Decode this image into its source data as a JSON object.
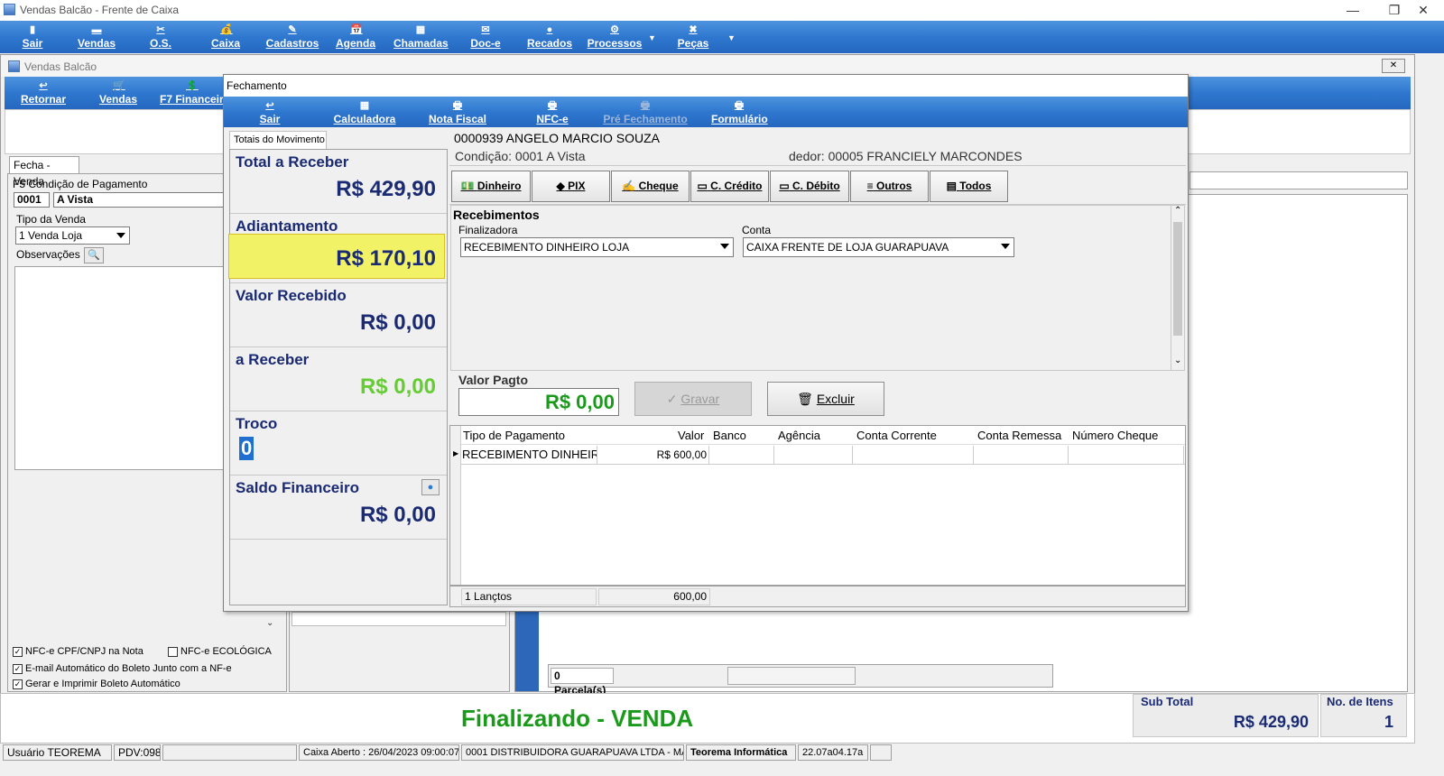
{
  "window": {
    "title": "Vendas Balcão - Frente de Caixa",
    "minimize": "—",
    "restore": "❐",
    "close": "✕"
  },
  "main_toolbar": [
    {
      "label": "Sair",
      "icon": "▮"
    },
    {
      "label": "Vendas",
      "icon": "▬"
    },
    {
      "label": "O.S.",
      "icon": "✂"
    },
    {
      "label": "Caixa",
      "icon": "💰"
    },
    {
      "label": "Cadastros",
      "icon": "✎"
    },
    {
      "label": "Agenda",
      "icon": "📅"
    },
    {
      "label": "Chamadas",
      "icon": "▦"
    },
    {
      "label": "Doc-e",
      "icon": "✉"
    },
    {
      "label": "Recados",
      "icon": "●"
    },
    {
      "label": "Processos",
      "icon": "⚙"
    },
    {
      "label": "Peças",
      "icon": "✖"
    }
  ],
  "child_window": {
    "title": "Vendas Balcão",
    "close": "✕"
  },
  "child_toolbar": [
    {
      "label": "Retornar",
      "icon": "↩"
    },
    {
      "label": "Vendas",
      "icon": "🛒"
    },
    {
      "label": "F7 Financeiro",
      "icon": "💲"
    }
  ],
  "form": {
    "tab": "Fecha - Venda",
    "condicao_label": "F5 Condição de Pagamento",
    "condicao_code": "0001",
    "condicao_name": "A Vista",
    "tipo_label": "Tipo da Venda",
    "tipo_value": "1 Venda Loja",
    "obs_label": "Observações",
    "checks": [
      {
        "label": "NFC-e CPF/CNPJ na Nota",
        "checked": true
      },
      {
        "label": "NFC-e ECOLÓGICA",
        "checked": false
      },
      {
        "label": "E-mail Automático do Boleto Junto com a NF-e",
        "checked": true
      },
      {
        "label": "Gerar e Imprimir Boleto Automático",
        "checked": true
      }
    ],
    "parcelas": "0 Parcela(s)"
  },
  "footer": {
    "finalizando": "Finalizando - VENDA",
    "subtotal_label": "Sub Total",
    "subtotal_value": "R$ 429,90",
    "itens_label": "No. de Itens",
    "itens_value": "1"
  },
  "status_bar": [
    "Usuário TEOREMA",
    "PDV:098",
    "",
    "Caixa Aberto : 26/04/2023 09:00:07",
    "0001 DISTRIBUIDORA GUARAPUAVA LTDA - MA",
    "Teorema Informática",
    "22.07a04.17a",
    ""
  ],
  "dialog": {
    "title": "Fechamento",
    "toolbar": [
      {
        "label": "Sair",
        "icon": "↩",
        "enabled": true
      },
      {
        "label": "Calculadora",
        "icon": "▦",
        "enabled": true
      },
      {
        "label": "Nota Fiscal",
        "icon": "🖶",
        "enabled": true
      },
      {
        "label": "NFC-e",
        "icon": "🖶",
        "enabled": true
      },
      {
        "label": "Pré Fechamento",
        "icon": "🖶",
        "enabled": false
      },
      {
        "label": "Formulário",
        "icon": "🖶",
        "enabled": true
      }
    ],
    "totals_tab": "Totais do Movimento",
    "totals": [
      {
        "label": "Total a Receber",
        "value": "R$ 429,90"
      },
      {
        "label": "Adiantamento",
        "value": "R$ 170,10"
      },
      {
        "label": "Valor Recebido",
        "value": "R$ 0,00"
      },
      {
        "label": "a Receber",
        "value": "R$ 0,00"
      },
      {
        "label": "Troco",
        "value": "0"
      },
      {
        "label": "Saldo Financeiro",
        "value": "R$ 0,00"
      }
    ],
    "cliente": "0000939 ANGELO MARCIO SOUZA",
    "condicao": "Condição: 0001 A Vista",
    "vendedor": "dedor: 00005 FRANCIELY MARCONDES",
    "pay_buttons": [
      {
        "label": "Dinheiro",
        "icon": "💵"
      },
      {
        "label": "PIX",
        "icon": "◆"
      },
      {
        "label": "Cheque",
        "icon": "✍"
      },
      {
        "label": "C. Crédito",
        "icon": "▭"
      },
      {
        "label": "C. Débito",
        "icon": "▭"
      },
      {
        "label": "Outros",
        "icon": "≡"
      },
      {
        "label": "Todos",
        "icon": "▤"
      }
    ],
    "recebimentos": {
      "title": "Recebimentos",
      "finalizadora_label": "Finalizadora",
      "finalizadora_value": "RECEBIMENTO DINHEIRO LOJA",
      "conta_label": "Conta",
      "conta_value": "CAIXA FRENTE DE LOJA GUARAPUAVA"
    },
    "valor_pago_label": "Valor Pagto",
    "valor_pago_value": "R$ 0,00",
    "gravar": "Gravar",
    "excluir": "Excluir",
    "grid": {
      "headers": [
        "Tipo de Pagamento",
        "Valor",
        "Banco",
        "Agência",
        "Conta Corrente",
        "Conta Remessa",
        "Número Cheque"
      ],
      "rows": [
        [
          "RECEBIMENTO DINHEIR",
          "R$ 600,00",
          "",
          "",
          "",
          "",
          ""
        ]
      ]
    },
    "grid_footer": {
      "count": "1 Lançtos",
      "total": "600,00"
    }
  },
  "colors": {
    "toolbar_blue": "#2f78cf",
    "navy": "#1a2a73",
    "green_total": "#1a9a1a",
    "light_green": "#66cc33",
    "highlight_yellow": "#f2f266"
  }
}
